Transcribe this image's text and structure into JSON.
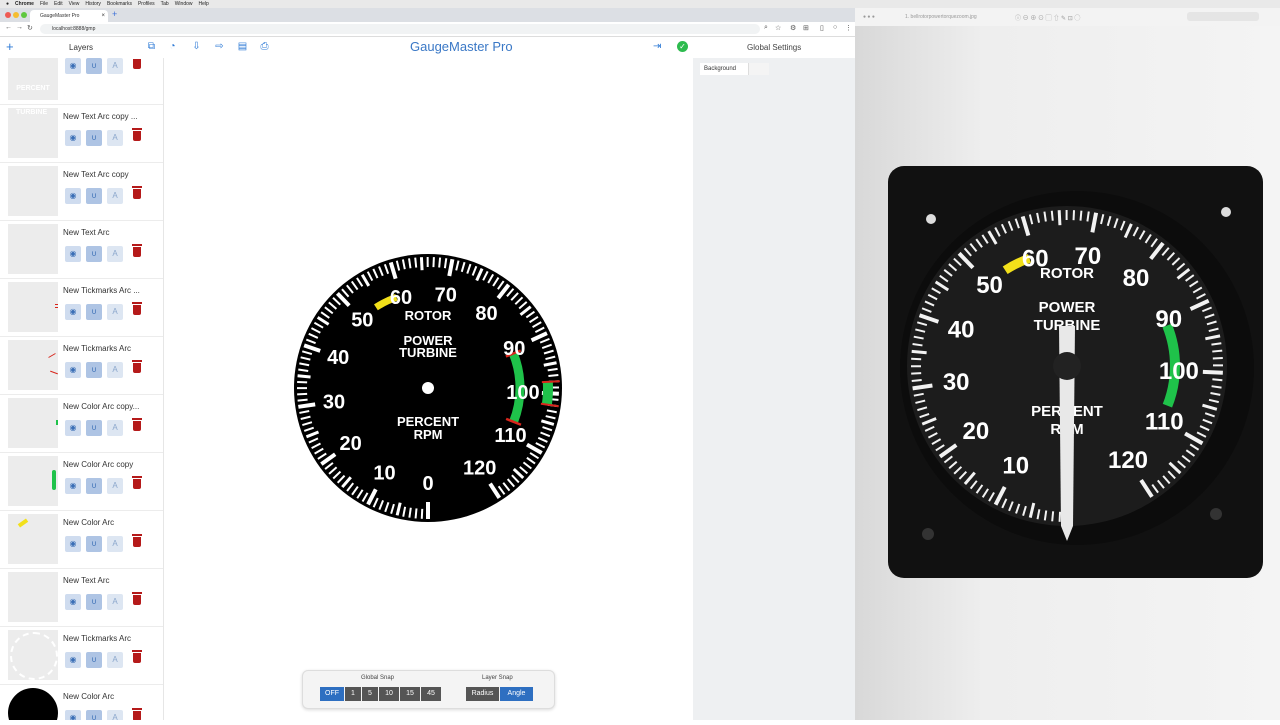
{
  "mac_menu": [
    "Chrome",
    "File",
    "Edit",
    "View",
    "History",
    "Bookmarks",
    "Profiles",
    "Tab",
    "Window",
    "Help"
  ],
  "browser": {
    "tab_title": "GaugeMaster Pro",
    "url": "localhost:8888/gmp"
  },
  "app": {
    "title": "GaugeMaster Pro",
    "layers_title": "Layers",
    "global_settings_title": "Global Settings",
    "background_label": "Background"
  },
  "layers": [
    {
      "name": "New Text Arc copy ..."
    },
    {
      "name": "New Text Arc copy"
    },
    {
      "name": "New Text Arc"
    },
    {
      "name": "New Tickmarks Arc ..."
    },
    {
      "name": "New Tickmarks Arc"
    },
    {
      "name": "New Color Arc copy..."
    },
    {
      "name": "New Color Arc copy"
    },
    {
      "name": "New Color Arc"
    },
    {
      "name": "New Text Arc"
    },
    {
      "name": "New Tickmarks Arc"
    },
    {
      "name": "New Color Arc"
    }
  ],
  "layer_thumb_text": {
    "percent": "PERCENT",
    "turbine": "TURBINE"
  },
  "snap": {
    "global_label": "Global Snap",
    "global_options": [
      "OFF",
      "1",
      "5",
      "10",
      "15",
      "45"
    ],
    "layer_label": "Layer Snap",
    "layer_options": [
      "Radius",
      "Angle"
    ]
  },
  "gauge": {
    "numbers": [
      "0",
      "10",
      "20",
      "30",
      "40",
      "50",
      "60",
      "70",
      "80",
      "90",
      "100",
      "110",
      "120"
    ],
    "line1": "ROTOR",
    "line2": "POWER",
    "line3": "TURBINE",
    "line4": "PERCENT",
    "line5": "RPM",
    "colors": {
      "face": "#000000",
      "text": "#ffffff",
      "yellow": "#f2e01a",
      "green": "#1fc24a",
      "red": "#d8261c"
    }
  },
  "viewer": {
    "filename": "1. bellrotorpowertorquezoom.jpg"
  },
  "photo_gauge": {
    "numbers": [
      "10",
      "20",
      "30",
      "40",
      "50",
      "60",
      "70",
      "80",
      "90",
      "100",
      "110",
      "120"
    ],
    "line1": "ROTOR",
    "line2": "POWER",
    "line3": "TURBINE",
    "line4": "PERCENT",
    "line5": "RPM"
  }
}
